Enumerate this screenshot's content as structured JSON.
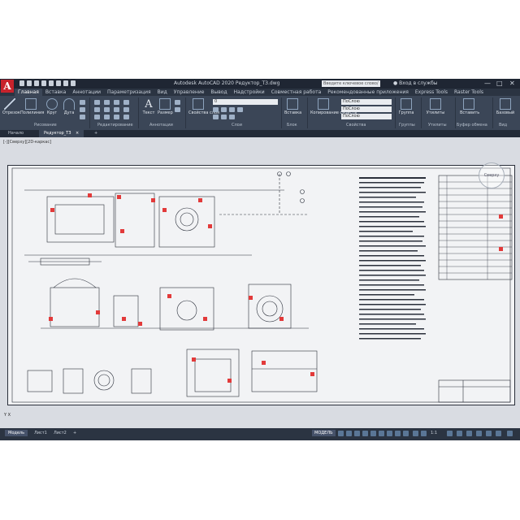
{
  "app": {
    "logo_letter": "A",
    "title": "Autodesk AutoCAD 2020   Редуктор_ТЗ.dwg",
    "search_placeholder": "Введите ключевое слово/фразу",
    "user_label": "Вход в службы",
    "window_controls": [
      "—",
      "□",
      "✕"
    ]
  },
  "menubar": {
    "items": [
      "Главная",
      "Вставка",
      "Аннотации",
      "Параметризация",
      "Вид",
      "Управление",
      "Вывод",
      "Надстройки",
      "Совместная работа",
      "Рекомендованные приложения",
      "Express Tools",
      "Raster Tools"
    ],
    "active_index": 0
  },
  "ribbon": {
    "draw_tools": [
      "Отрезок",
      "Полилиния",
      "Круг",
      "Дуга"
    ],
    "annotation_tools": [
      "Текст",
      "Размер"
    ],
    "layer_tool": "Свойства слоя",
    "layer_value": "0",
    "insert_tool": "Вставка",
    "match_tool": "Копирование свойств",
    "properties_values": [
      "ПоСлою",
      "ПоСлою",
      "ПоСлою"
    ],
    "group_tool": "Группа",
    "utilities_tool": "Утилиты",
    "clipboard_tool": "Вставить",
    "view_tool": "Базовый",
    "panels": [
      "Рисование",
      "Редактирование",
      "Аннотации",
      "Слои",
      "Блок",
      "Свойства",
      "Группы",
      "Утилиты",
      "Буфер обмена",
      "Вид"
    ]
  },
  "doc_tabs": {
    "start": "Начало",
    "active": "Редуктор_ТЗ",
    "add": "+"
  },
  "viewport_label": "[-][Сверху][2D-каркас]",
  "viewcube_label": "Сверху",
  "ucs_label": "Y   X",
  "status": {
    "layout_tabs": [
      "Модель",
      "Лист1",
      "Лист2",
      "+"
    ],
    "active_tab": 0,
    "mode": "МОДЕЛЬ",
    "scale": "1:1"
  }
}
